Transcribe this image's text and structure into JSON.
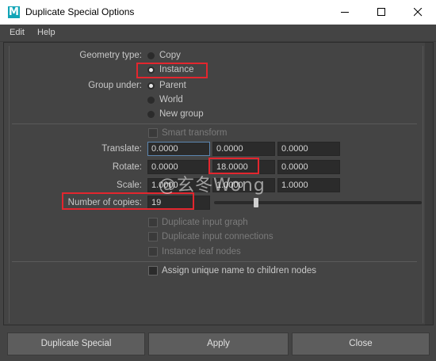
{
  "window": {
    "title": "Duplicate Special Options",
    "app_icon_letter": "M"
  },
  "menu": [
    {
      "label": "Edit"
    },
    {
      "label": "Help"
    }
  ],
  "geometry_type": {
    "label": "Geometry type:",
    "options": [
      "Copy",
      "Instance"
    ],
    "selected": "Instance"
  },
  "group_under": {
    "label": "Group under:",
    "options": [
      "Parent",
      "World",
      "New group"
    ],
    "selected": "Parent"
  },
  "smart_transform": {
    "label": "Smart transform",
    "enabled": false,
    "checked": false
  },
  "translate": {
    "label": "Translate:",
    "x": "0.0000",
    "y": "0.0000",
    "z": "0.0000"
  },
  "rotate": {
    "label": "Rotate:",
    "x": "0.0000",
    "y": "18.0000",
    "z": "0.0000"
  },
  "scale": {
    "label": "Scale:",
    "x": "1.0000",
    "y": "1.0000",
    "z": "1.0000"
  },
  "copies": {
    "label": "Number of copies:",
    "value": "19",
    "slider_fraction": 0.19
  },
  "options": [
    {
      "label": "Duplicate input graph",
      "enabled": false
    },
    {
      "label": "Duplicate input connections",
      "enabled": false
    },
    {
      "label": "Instance leaf nodes",
      "enabled": false
    }
  ],
  "assign_unique": {
    "label": "Assign unique name to children nodes",
    "enabled": true,
    "checked": false
  },
  "watermark": "@玄冬Wong",
  "buttons": {
    "duplicate": "Duplicate Special",
    "apply": "Apply",
    "close": "Close"
  },
  "colors": {
    "highlight": "#e3262e",
    "maya_teal": "#12a5b7"
  }
}
